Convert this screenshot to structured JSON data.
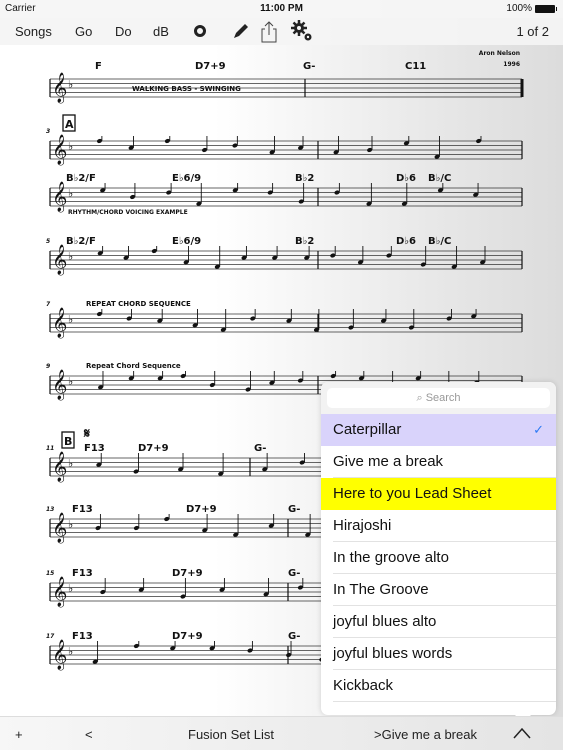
{
  "status": {
    "carrier": "Carrier",
    "time": "11:00 PM",
    "battery": "100%"
  },
  "toolbar": {
    "songs": "Songs",
    "go": "Go",
    "do": "Do",
    "db": "dB",
    "page": "1 of 2",
    "icons": [
      "record-icon",
      "pencil-icon",
      "share-icon",
      "gear-icon"
    ]
  },
  "sheet": {
    "composer": "Aron Nelson",
    "year": "1996",
    "systems": [
      {
        "num": "",
        "rehearsal": "",
        "chords": [
          "F",
          "D7+9",
          "G-",
          "C11"
        ],
        "text": "WALKING BASS - SWINGING"
      },
      {
        "num": "3",
        "rehearsal": "A",
        "chords": [],
        "text": ""
      },
      {
        "num": "",
        "rehearsal": "",
        "chords": [
          "B♭2/F",
          "E♭6/9",
          "B♭2",
          "D♭6",
          "B♭/C"
        ],
        "text": "RHYTHM/CHORD VOICING EXAMPLE"
      },
      {
        "num": "5",
        "rehearsal": "",
        "chords": [
          "B♭2/F",
          "E♭6/9",
          "B♭2",
          "D♭6",
          "B♭/C"
        ],
        "text": ""
      },
      {
        "num": "7",
        "rehearsal": "",
        "chords": [],
        "text": "REPEAT CHORD SEQUENCE"
      },
      {
        "num": "9",
        "rehearsal": "",
        "chords": [],
        "text": "Repeat Chord Sequence"
      },
      {
        "num": "11",
        "rehearsal": "B",
        "chords": [
          "F13",
          "D7+9",
          "G-"
        ],
        "text": ""
      },
      {
        "num": "13",
        "rehearsal": "",
        "chords": [
          "F13",
          "D7+9",
          "G-"
        ],
        "text": ""
      },
      {
        "num": "15",
        "rehearsal": "",
        "chords": [
          "F13",
          "D7+9",
          "G-"
        ],
        "text": ""
      },
      {
        "num": "17",
        "rehearsal": "",
        "chords": [
          "F13",
          "D7+9",
          "G-"
        ],
        "text": ""
      }
    ]
  },
  "popup": {
    "search_placeholder": "Search",
    "items": [
      {
        "label": "Caterpillar",
        "state": "selected"
      },
      {
        "label": "Give me a break",
        "state": ""
      },
      {
        "label": "Here to you Lead Sheet",
        "state": "highlighted"
      },
      {
        "label": "Hirajoshi",
        "state": ""
      },
      {
        "label": "In the groove alto",
        "state": ""
      },
      {
        "label": "In The Groove",
        "state": ""
      },
      {
        "label": "joyful blues alto",
        "state": ""
      },
      {
        "label": "joyful blues words",
        "state": ""
      },
      {
        "label": "Kickback",
        "state": ""
      }
    ],
    "colors": {
      "selected": "#d9d3fb",
      "highlighted": "#ffff00",
      "check": "#2f7bf5"
    }
  },
  "bottom": {
    "add": "+",
    "prev": "<",
    "setlist": "Fusion Set List",
    "next": ">Give me a break"
  }
}
